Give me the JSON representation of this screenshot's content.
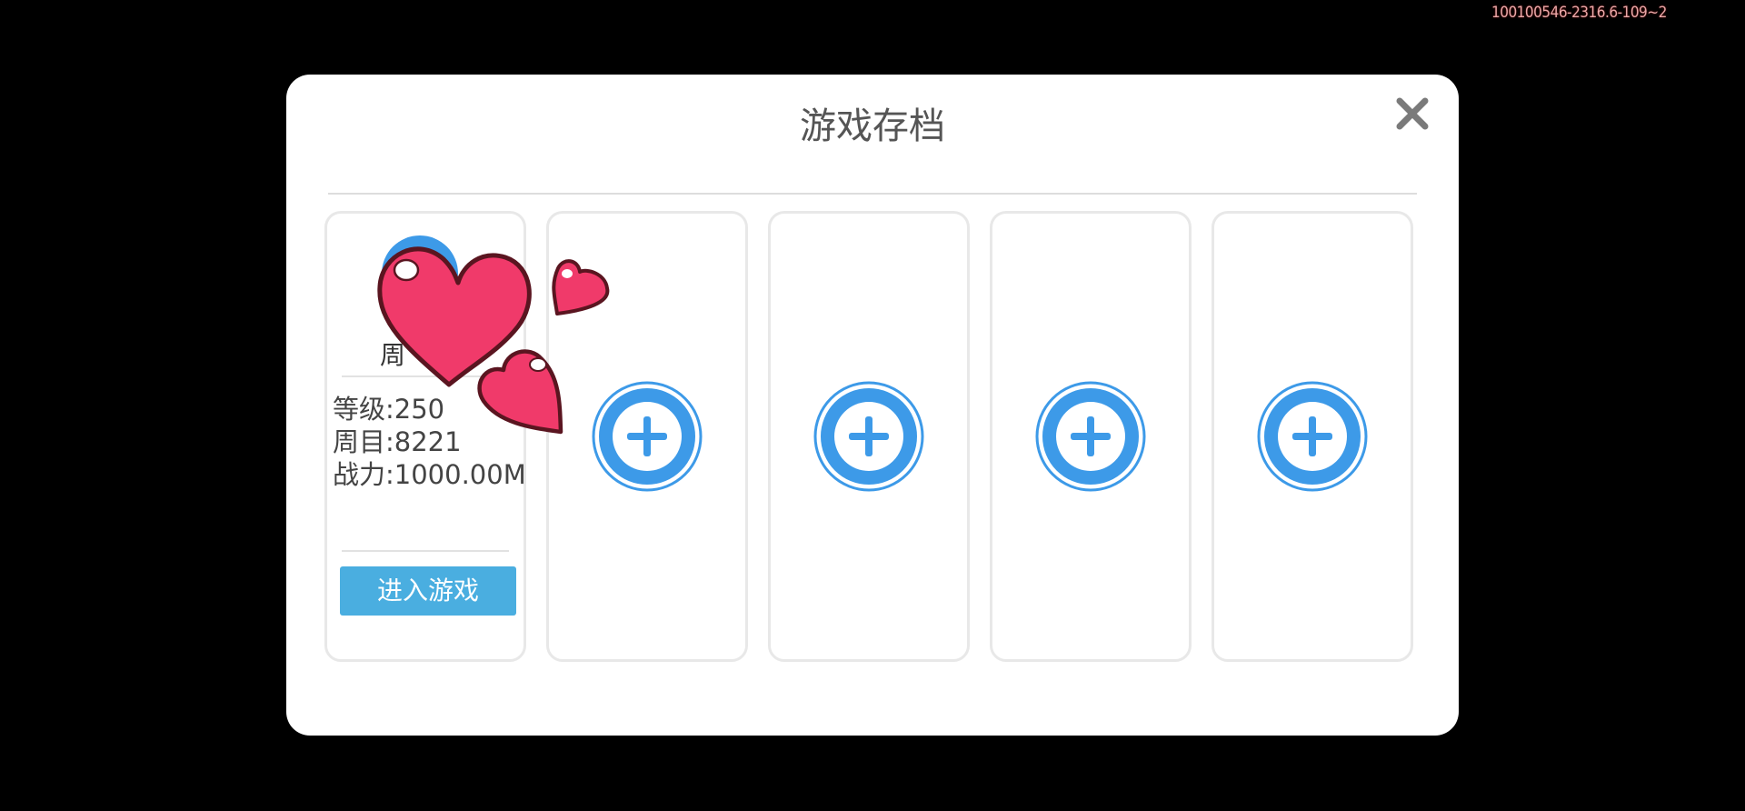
{
  "build_tag": "100100546-2316.6-109~2",
  "dialog": {
    "title": "游戏存档",
    "close_icon": "close-icon"
  },
  "save_slot": {
    "name_partial": "周",
    "level": "等级:250",
    "round": "周目:8221",
    "power": "战力:1000.00M",
    "enter_label": "进入游戏"
  },
  "empty_slots": [
    {
      "icon": "add-icon"
    },
    {
      "icon": "add-icon"
    },
    {
      "icon": "add-icon"
    },
    {
      "icon": "add-icon"
    }
  ],
  "colors": {
    "accent_blue": "#3d9ae8",
    "enter_button": "#4aaee0",
    "heart_pink": "#f03a6a",
    "heart_outline": "#5a1520"
  }
}
